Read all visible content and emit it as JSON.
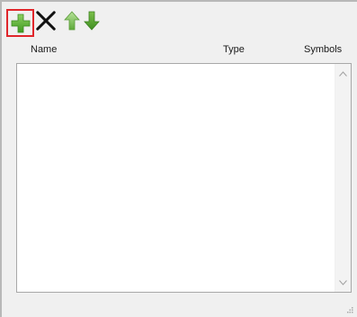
{
  "toolbar": {
    "buttons": [
      {
        "name": "add",
        "icon": "plus-icon",
        "color": "#5fb336",
        "selected": true
      },
      {
        "name": "delete",
        "icon": "x-icon",
        "color": "#111111"
      },
      {
        "name": "move-up",
        "icon": "arrow-up-icon",
        "color": "#7cc04b"
      },
      {
        "name": "move-down",
        "icon": "arrow-down-icon",
        "color": "#4f9e2c"
      }
    ]
  },
  "table": {
    "columns": [
      {
        "label": "Name"
      },
      {
        "label": "Type"
      },
      {
        "label": "Symbols"
      }
    ],
    "rows": []
  },
  "colors": {
    "selection_border": "#e0262b",
    "panel_background": "#f0f0f0"
  }
}
